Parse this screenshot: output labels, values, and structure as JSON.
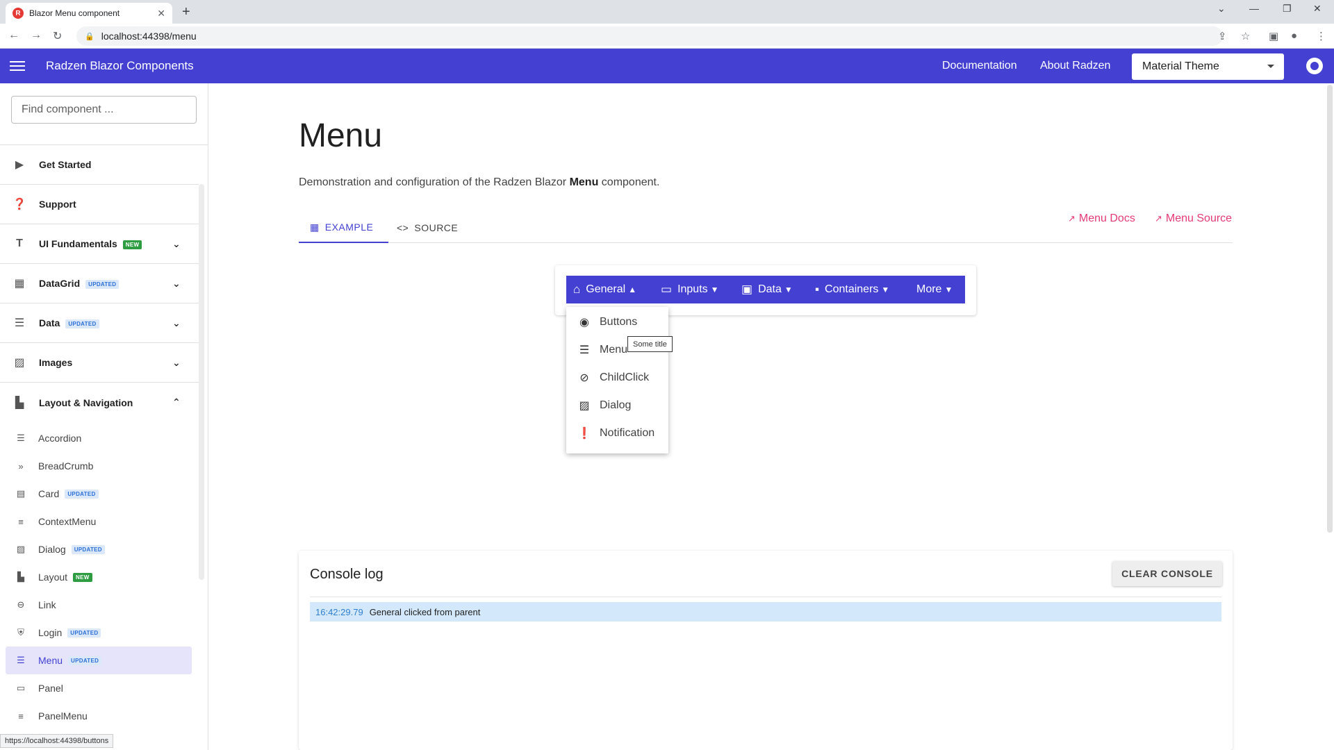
{
  "browser": {
    "tab_title": "Blazor Menu component",
    "favicon_letter": "R",
    "url": "localhost:44398/menu",
    "status_url": "https://localhost:44398/buttons"
  },
  "header": {
    "title": "Radzen Blazor Components",
    "links": [
      "Documentation",
      "About Radzen"
    ],
    "theme": "Material Theme",
    "accent": "#4340d2"
  },
  "sidebar": {
    "search_placeholder": "Find component ...",
    "groups": [
      {
        "label": "Get Started",
        "icon": "play-icon"
      },
      {
        "label": "Support",
        "icon": "help-icon"
      },
      {
        "label": "UI Fundamentals",
        "badge": "NEW",
        "icon": "palette-icon"
      },
      {
        "label": "DataGrid",
        "badge": "UPDATED",
        "icon": "grid-icon"
      },
      {
        "label": "Data",
        "badge": "UPDATED",
        "icon": "list-icon"
      },
      {
        "label": "Images",
        "icon": "image-icon"
      },
      {
        "label": "Layout & Navigation",
        "icon": "layout-icon"
      }
    ],
    "sub_items": [
      {
        "label": "Accordion"
      },
      {
        "label": "BreadCrumb"
      },
      {
        "label": "Card",
        "badge": "UPDATED"
      },
      {
        "label": "ContextMenu"
      },
      {
        "label": "Dialog",
        "badge": "UPDATED"
      },
      {
        "label": "Layout",
        "badge": "NEW"
      },
      {
        "label": "Link"
      },
      {
        "label": "Login",
        "badge": "UPDATED"
      },
      {
        "label": "Menu",
        "badge": "UPDATED"
      },
      {
        "label": "Panel"
      },
      {
        "label": "PanelMenu"
      }
    ]
  },
  "main": {
    "title": "Menu",
    "desc_prefix": "Demonstration and configuration of the Radzen Blazor ",
    "desc_bold": "Menu",
    "desc_suffix": " component.",
    "tabs": [
      "EXAMPLE",
      "SOURCE"
    ],
    "doc_links": [
      "Menu Docs",
      "Menu Source"
    ]
  },
  "menu": {
    "items": [
      "General",
      "Inputs",
      "Data",
      "Containers",
      "More"
    ],
    "dropdown": [
      "Buttons",
      "Menu",
      "ChildClick",
      "Dialog",
      "Notification"
    ],
    "tooltip": "Some title"
  },
  "console": {
    "title": "Console log",
    "clear_label": "CLEAR CONSOLE",
    "entries": [
      {
        "time": "16:42:29.79",
        "message": "General clicked from parent"
      }
    ]
  }
}
